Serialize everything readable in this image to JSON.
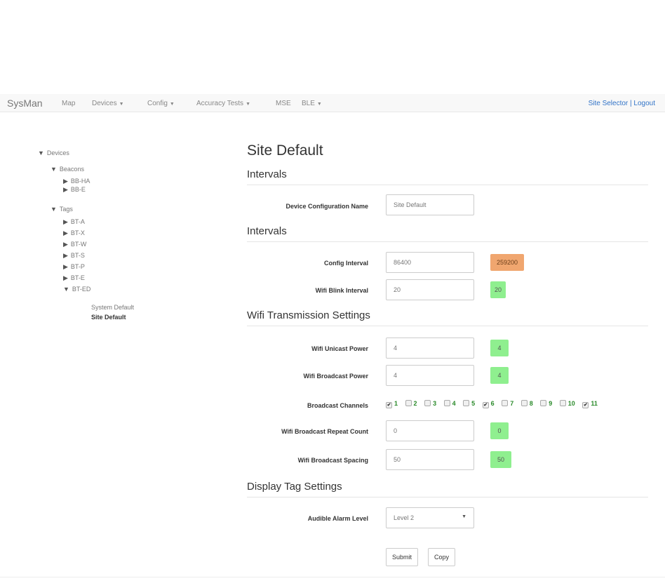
{
  "navbar": {
    "brand": "SysMan",
    "items": [
      {
        "label": "Map",
        "dropdown": false
      },
      {
        "label": "Devices",
        "dropdown": true
      },
      {
        "label": "Config",
        "dropdown": true
      },
      {
        "label": "Accuracy Tests",
        "dropdown": true
      },
      {
        "label": "MSE",
        "dropdown": false
      },
      {
        "label": "BLE",
        "dropdown": true
      }
    ],
    "right_link": "Site Selector | Logout"
  },
  "tree": {
    "root": "Devices",
    "beacons": {
      "label": "Beacons",
      "children": [
        "BB-HA",
        "BB-E"
      ]
    },
    "tags": {
      "label": "Tags",
      "children": [
        "BT-A",
        "BT-X",
        "BT-W",
        "BT-S",
        "BT-P",
        "BT-E",
        "BT-ED"
      ]
    },
    "bt_ed_children": [
      "System Default",
      "Site Default"
    ]
  },
  "page": {
    "title": "Site Default",
    "sections": {
      "intervals1": "Intervals",
      "intervals2": "Intervals",
      "wifi": "Wifi Transmission Settings",
      "display": "Display Tag Settings"
    }
  },
  "fields": {
    "config_name": {
      "label": "Device Configuration Name",
      "value": "Site Default"
    },
    "config_interval": {
      "label": "Config Interval",
      "value": "86400",
      "badge": "259200"
    },
    "wifi_blink": {
      "label": "Wifi Blink Interval",
      "value": "20",
      "badge": "20"
    },
    "unicast_power": {
      "label": "Wifi Unicast Power",
      "value": "4",
      "badge": "4"
    },
    "broadcast_power": {
      "label": "Wifi Broadcast Power",
      "value": "4",
      "badge": "4"
    },
    "broadcast_channels": {
      "label": "Broadcast Channels"
    },
    "repeat_count": {
      "label": "Wifi Broadcast Repeat Count",
      "value": "0",
      "badge": "0"
    },
    "spacing": {
      "label": "Wifi Broadcast Spacing",
      "value": "50",
      "badge": "50"
    },
    "alarm_level": {
      "label": "Audible Alarm Level",
      "value": "Level 2"
    }
  },
  "channels": [
    {
      "num": "1",
      "checked": true
    },
    {
      "num": "2",
      "checked": false
    },
    {
      "num": "3",
      "checked": false
    },
    {
      "num": "4",
      "checked": false
    },
    {
      "num": "5",
      "checked": false
    },
    {
      "num": "6",
      "checked": true
    },
    {
      "num": "7",
      "checked": false
    },
    {
      "num": "8",
      "checked": false
    },
    {
      "num": "9",
      "checked": false
    },
    {
      "num": "10",
      "checked": false
    },
    {
      "num": "11",
      "checked": true
    }
  ],
  "buttons": {
    "submit": "Submit",
    "copy": "Copy"
  },
  "colors": {
    "badge_green": "#8fef8f",
    "badge_orange": "#f0a66f",
    "link": "#3173c7"
  }
}
